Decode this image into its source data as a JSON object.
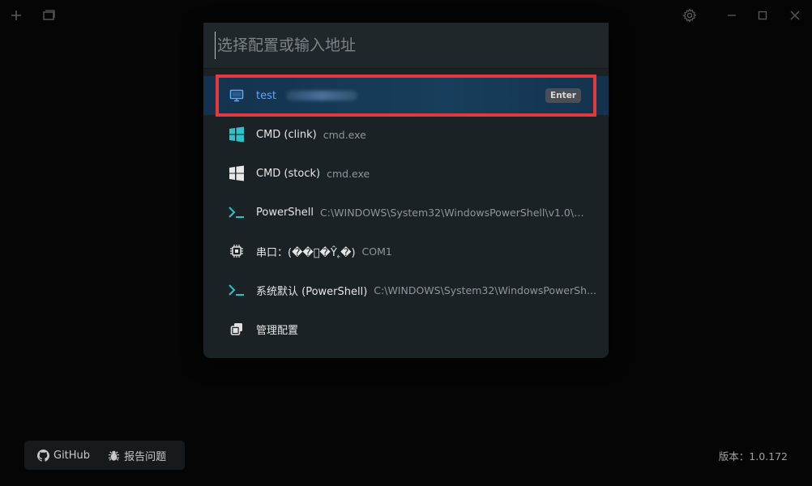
{
  "search": {
    "placeholder": "选择配置或输入地址",
    "value": ""
  },
  "profiles": [
    {
      "icon": "monitor-icon",
      "name": "test",
      "detail": "",
      "selected": true,
      "shortcut": "Enter"
    },
    {
      "icon": "windows-icon",
      "name": "CMD (clink)",
      "detail": "cmd.exe"
    },
    {
      "icon": "windows-icon",
      "name": "CMD (stock)",
      "detail": "cmd.exe"
    },
    {
      "icon": "terminal-prompt-icon",
      "name": "PowerShell",
      "detail": "C:\\WINDOWS\\System32\\WindowsPowerShell\\v1.0\\po..."
    },
    {
      "icon": "chip-icon",
      "name": "串口：(��ͨ�Ŷ˿�)",
      "detail": "COM1"
    },
    {
      "icon": "terminal-prompt-icon",
      "name": "系统默认 (PowerShell)",
      "detail": "C:\\WINDOWS\\System32\\WindowsPowerSh..."
    },
    {
      "icon": "copy-icon",
      "name": "管理配置",
      "detail": ""
    }
  ],
  "footer": {
    "github_label": "GitHub",
    "report_label": "报告问题",
    "version": "版本：1.0.172"
  },
  "colors": {
    "accent": "#58a9ff",
    "highlight": "#e5383b",
    "windows": "#2dc3c9"
  }
}
